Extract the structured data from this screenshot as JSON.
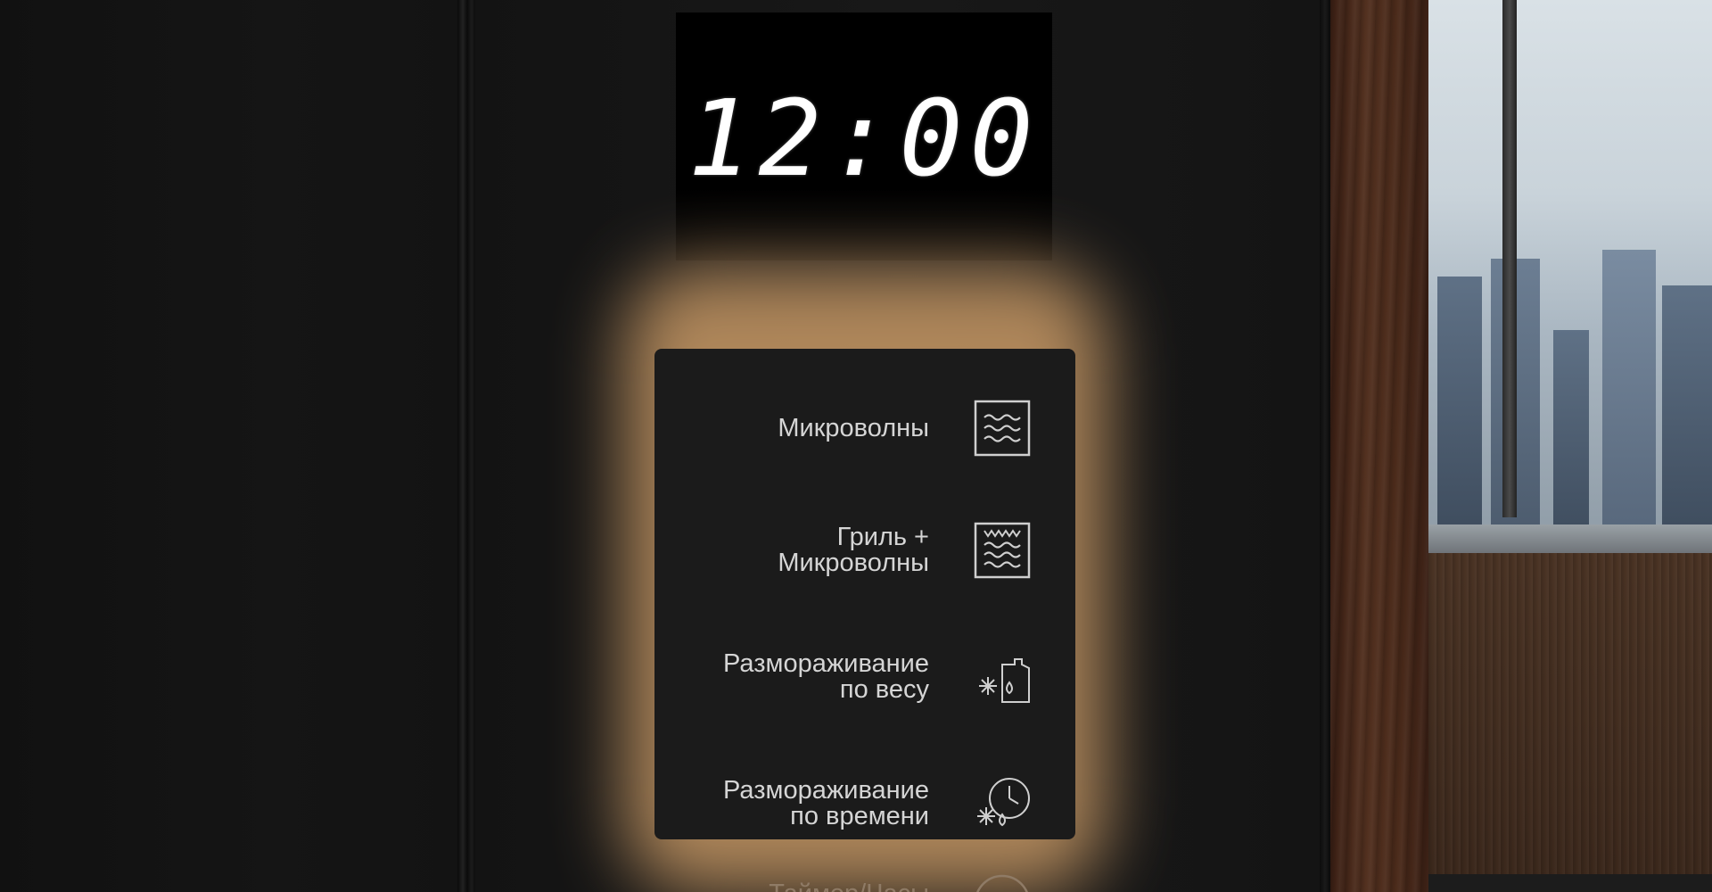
{
  "display": {
    "time": "12:00"
  },
  "modes": [
    {
      "line1": "Микроволны",
      "line2": "",
      "icon": "microwave-waves-icon"
    },
    {
      "line1": "Гриль +",
      "line2": "Микроволны",
      "icon": "grill-microwave-icon"
    },
    {
      "line1": "Размораживание",
      "line2": "по весу",
      "icon": "defrost-weight-icon"
    },
    {
      "line1": "Размораживание",
      "line2": "по времени",
      "icon": "defrost-time-icon"
    }
  ],
  "partial_item": {
    "label": "Таймер/Часы",
    "icon": "timer-clock-icon"
  },
  "colors": {
    "glow": "#c99a66",
    "display_bg": "#000000",
    "panel_bg": "#1b1b1b",
    "text": "#d5d5d5"
  }
}
